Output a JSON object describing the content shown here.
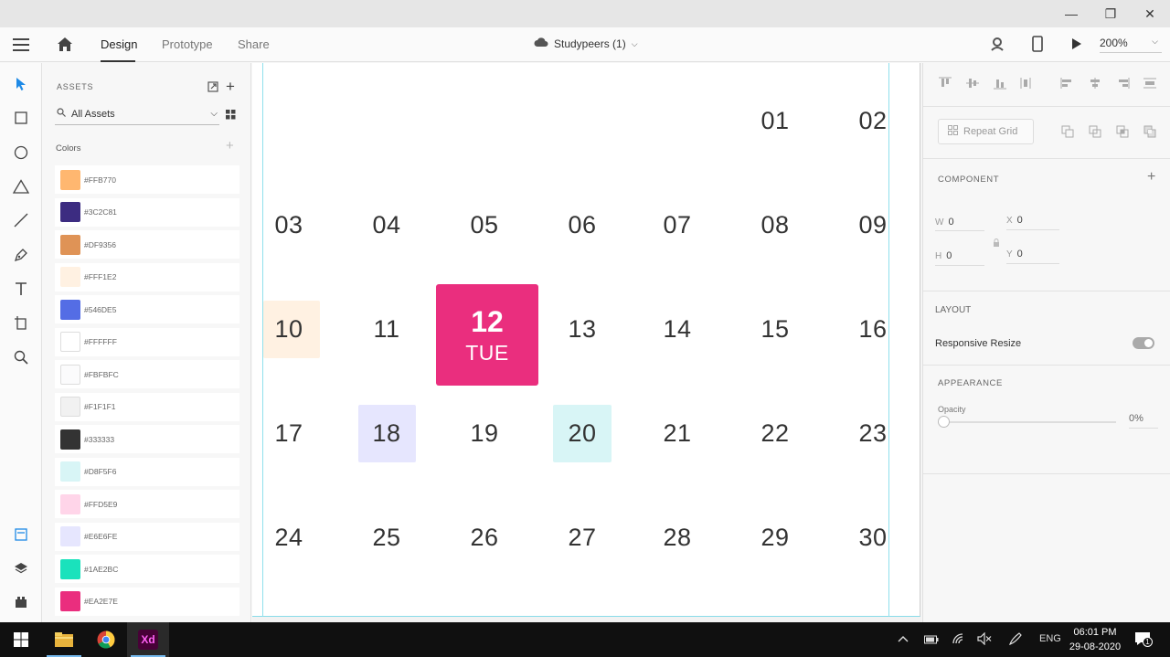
{
  "window": {
    "minimize": "—",
    "maximize": "❐",
    "close": "✕"
  },
  "app": {
    "tabs": [
      "Design",
      "Prototype",
      "Share"
    ],
    "doc_title": "Studypeers (1)",
    "zoom": "200%"
  },
  "assets": {
    "title": "ASSETS",
    "search_placeholder": "All Assets",
    "colors_label": "Colors",
    "colors": [
      {
        "hex": "#FFB770",
        "label": "#FFB770"
      },
      {
        "hex": "#3C2C81",
        "label": "#3C2C81"
      },
      {
        "hex": "#DF9356",
        "label": "#DF9356"
      },
      {
        "hex": "#FFF1E2",
        "label": "#FFF1E2"
      },
      {
        "hex": "#546DE5",
        "label": "#546DE5"
      },
      {
        "hex": "#FFFFFF",
        "label": "#FFFFFF"
      },
      {
        "hex": "#FBFBFC",
        "label": "#FBFBFC"
      },
      {
        "hex": "#F1F1F1",
        "label": "#F1F1F1"
      },
      {
        "hex": "#333333",
        "label": "#333333"
      },
      {
        "hex": "#D8F5F6",
        "label": "#D8F5F6"
      },
      {
        "hex": "#FFD5E9",
        "label": "#FFD5E9"
      },
      {
        "hex": "#E6E6FE",
        "label": "#E6E6FE"
      },
      {
        "hex": "#1AE2BC",
        "label": "#1AE2BC"
      },
      {
        "hex": "#EA2E7E",
        "label": "#EA2E7E"
      }
    ]
  },
  "calendar": {
    "week1": [
      "01",
      "02"
    ],
    "week2": [
      "03",
      "04",
      "05",
      "06",
      "07",
      "08",
      "09"
    ],
    "week3": [
      "10",
      "11",
      "12",
      "13",
      "14",
      "15",
      "16"
    ],
    "week4": [
      "17",
      "18",
      "19",
      "20",
      "21",
      "22",
      "23"
    ],
    "week5": [
      "24",
      "25",
      "26",
      "27",
      "28",
      "29",
      "30"
    ],
    "today_num": "12",
    "today_day": "TUE",
    "highlight_colors": {
      "d10": "#FFF1E2",
      "d18": "#E6E6FE",
      "d20": "#D8F5F6",
      "today": "#EA2E7E"
    }
  },
  "props": {
    "repeat_grid": "Repeat Grid",
    "component": "COMPONENT",
    "w_label": "W",
    "w": "0",
    "h_label": "H",
    "h": "0",
    "x_label": "X",
    "x": "0",
    "y_label": "Y",
    "y": "0",
    "layout": "LAYOUT",
    "responsive_resize": "Responsive Resize",
    "appearance": "APPEARANCE",
    "opacity_label": "Opacity",
    "opacity_value": "0%"
  },
  "taskbar": {
    "lang": "ENG",
    "time": "06:01 PM",
    "date": "29-08-2020",
    "notifications": "1"
  }
}
